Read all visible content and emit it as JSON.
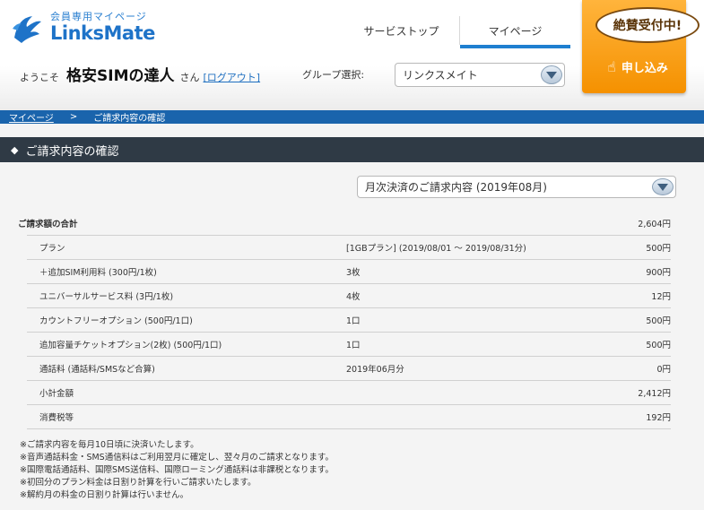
{
  "header": {
    "logo_sub": "会員専用マイページ",
    "logo_main": "LinksMate",
    "nav": [
      {
        "label": "サービストップ"
      },
      {
        "label": "マイページ"
      }
    ],
    "apply_bubble": "絶賛受付中!",
    "apply_label": "申し込み",
    "welcome_prefix": "ようこそ",
    "user_name": "格安SIMの達人",
    "welcome_suffix": "さん",
    "logout": "[ログアウト]",
    "group_label": "グループ選択:",
    "group_value": "リンクスメイト"
  },
  "breadcrumb": {
    "home": "マイページ",
    "separator": ">",
    "current": "ご請求内容の確認"
  },
  "section": {
    "title": "ご請求内容の確認",
    "month_select": "月次決済のご請求内容 (2019年08月)"
  },
  "billing": {
    "total": {
      "label": "ご請求額の合計",
      "amount": "2,604円"
    },
    "items": [
      {
        "label": "プラン",
        "detail": "[1GBプラン] (2019/08/01 ～ 2019/08/31分)",
        "amount": "500円"
      },
      {
        "label": "＋追加SIM利用料 (300円/1枚)",
        "detail": "3枚",
        "amount": "900円"
      },
      {
        "label": "ユニバーサルサービス料 (3円/1枚)",
        "detail": "4枚",
        "amount": "12円"
      },
      {
        "label": "カウントフリーオプション (500円/1口)",
        "detail": "1口",
        "amount": "500円"
      },
      {
        "label": "追加容量チケットオプション(2枚) (500円/1口)",
        "detail": "1口",
        "amount": "500円"
      },
      {
        "label": "通話料 (通話料/SMSなど合算)",
        "detail": "2019年06月分",
        "amount": "0円"
      },
      {
        "label": "小計金額",
        "detail": "",
        "amount": "2,412円"
      },
      {
        "label": "消費税等",
        "detail": "",
        "amount": "192円"
      }
    ]
  },
  "notes": [
    "※ご請求内容を毎月10日頃に決済いたします。",
    "※音声通話料金・SMS通信料はご利用翌月に確定し、翌々月のご請求となります。",
    "※国際電話通話料、国際SMS送信料、国際ローミング通話料は非課税となります。",
    "※初回分のプラン料金は日割り計算を行いご請求いたします。",
    "※解約月の料金の日割り計算は行いません。"
  ],
  "colors": {
    "brand_blue": "#1e73c8",
    "breadcrumb_bg": "#1a64ac",
    "section_bg": "#2f3a45",
    "apply_orange": "#f59100"
  }
}
